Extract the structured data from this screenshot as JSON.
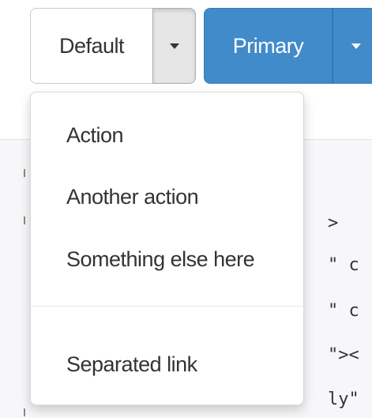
{
  "button_groups": {
    "default": {
      "label": "Default",
      "caret_icon": "caret-down-icon"
    },
    "primary": {
      "label": "Primary",
      "caret_icon": "caret-down-icon"
    }
  },
  "dropdown": {
    "items": [
      {
        "label": "Action"
      },
      {
        "label": "Another action"
      },
      {
        "label": "Something else here"
      },
      {
        "label": "Separated link"
      }
    ]
  },
  "code_snippet": {
    "lines": [
      ">",
      "\" c",
      "\" c",
      "\"><",
      "ly\""
    ]
  },
  "colors": {
    "primary": "#428bca",
    "default_bg": "#ffffff",
    "text": "#333333",
    "code_bg": "#f7f7f9"
  }
}
